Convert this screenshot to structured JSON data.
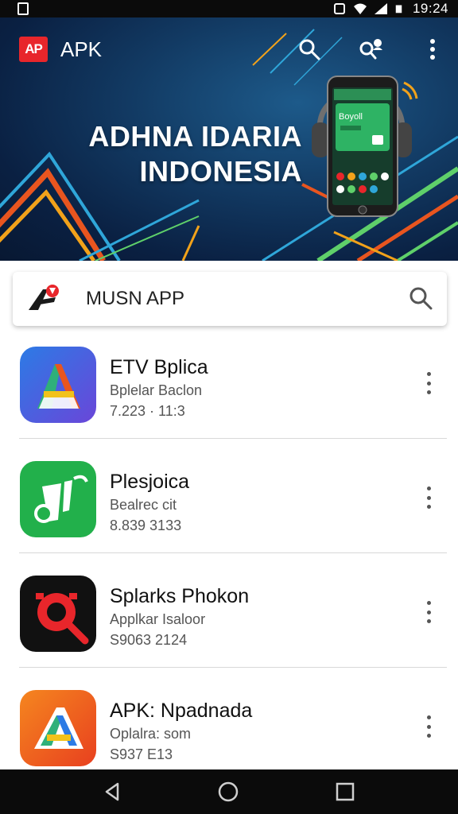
{
  "status_bar": {
    "time": "19:24"
  },
  "header": {
    "logo_text": "AP",
    "app_name": "APK",
    "banner_line1": "ADHNA IDARIA",
    "banner_line2": "INDONESIA",
    "phone_screen_text": "Boyoll"
  },
  "search": {
    "value": "MUSN APP"
  },
  "apps": [
    {
      "title": "ETV Bplica",
      "subtitle": "Bplelar Baclon",
      "meta": "7.223 · 11:3"
    },
    {
      "title": "Plesjoica",
      "subtitle": "Bealrec cit",
      "meta": "8.839  3133"
    },
    {
      "title": "Splarks Phokon",
      "subtitle": "Applkar Isaloor",
      "meta": "S9063 2124"
    },
    {
      "title": "APK: Npadnada",
      "subtitle": "Oplalra: som",
      "meta": "S937  E13"
    }
  ],
  "colors": {
    "accent_red": "#e8262b",
    "banner_dark": "#0a2042",
    "nav_bg": "#0b0b0b"
  },
  "icons": {
    "search": "search-icon",
    "account": "account-search-icon",
    "menu": "more-vert-icon"
  }
}
